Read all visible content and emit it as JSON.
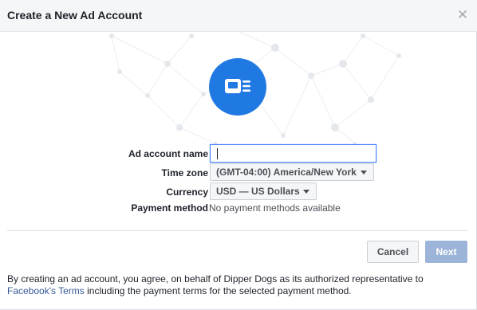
{
  "dialog": {
    "title": "Create a New Ad Account",
    "close_icon": "close-icon",
    "hero_icon": "ad-account-icon"
  },
  "colors": {
    "accent": "#2079e3",
    "next_disabled": "#9cb4d8",
    "link": "#365899",
    "header_bg": "#f5f6f7"
  },
  "form": {
    "ad_account_name": {
      "label": "Ad account name",
      "value": ""
    },
    "time_zone": {
      "label": "Time zone",
      "value": "(GMT-04:00) America/New York"
    },
    "currency": {
      "label": "Currency",
      "value": "USD — US Dollars"
    },
    "payment_method": {
      "label": "Payment method",
      "value": "No payment methods available"
    }
  },
  "buttons": {
    "cancel": "Cancel",
    "next": "Next"
  },
  "footer": {
    "text_before": "By creating an ad account, you agree, on behalf of Dipper Dogs as its authorized representative to ",
    "link": "Facebook's Terms",
    "text_after": " including the payment terms for the selected payment method."
  }
}
